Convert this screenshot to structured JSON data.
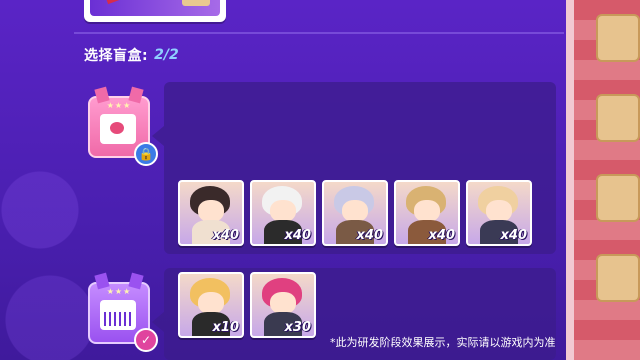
{
  "header": {
    "title": "选择盲盒:",
    "count": "2/2"
  },
  "blind_boxes": [
    {
      "name": "box-1",
      "color": "#f06aa8",
      "stars": "★★★",
      "badge": "lock-icon",
      "status": "locked",
      "items": [
        {
          "qty": "x40",
          "hair": "#3a2a2a",
          "body": "#f0e0d0"
        },
        {
          "qty": "x40",
          "hair": "#f2f2f2",
          "body": "#2b2b2b"
        },
        {
          "qty": "x40",
          "hair": "#c9c9e6",
          "body": "#7a5a45"
        },
        {
          "qty": "x40",
          "hair": "#d9b272",
          "body": "#8b5a3c"
        },
        {
          "qty": "x40",
          "hair": "#f0d0a0",
          "body": "#3a3a55"
        }
      ]
    },
    {
      "name": "box-2",
      "color": "#9a52f0",
      "stars": "★★★",
      "badge": "check-icon",
      "status": "selected",
      "items": [
        {
          "qty": "x10",
          "hair": "#f2c060",
          "body": "#2a2a2a"
        },
        {
          "qty": "x30",
          "hair": "#e04080",
          "body": "#3a3a50"
        }
      ]
    }
  ],
  "footer": {
    "disclaimer": "*此为研发阶段效果展示，实际请以游戏内为准"
  },
  "colors": {
    "background": "#4a1fb0",
    "accent": "#8fd0ff",
    "panel": "#3c1c8c"
  }
}
